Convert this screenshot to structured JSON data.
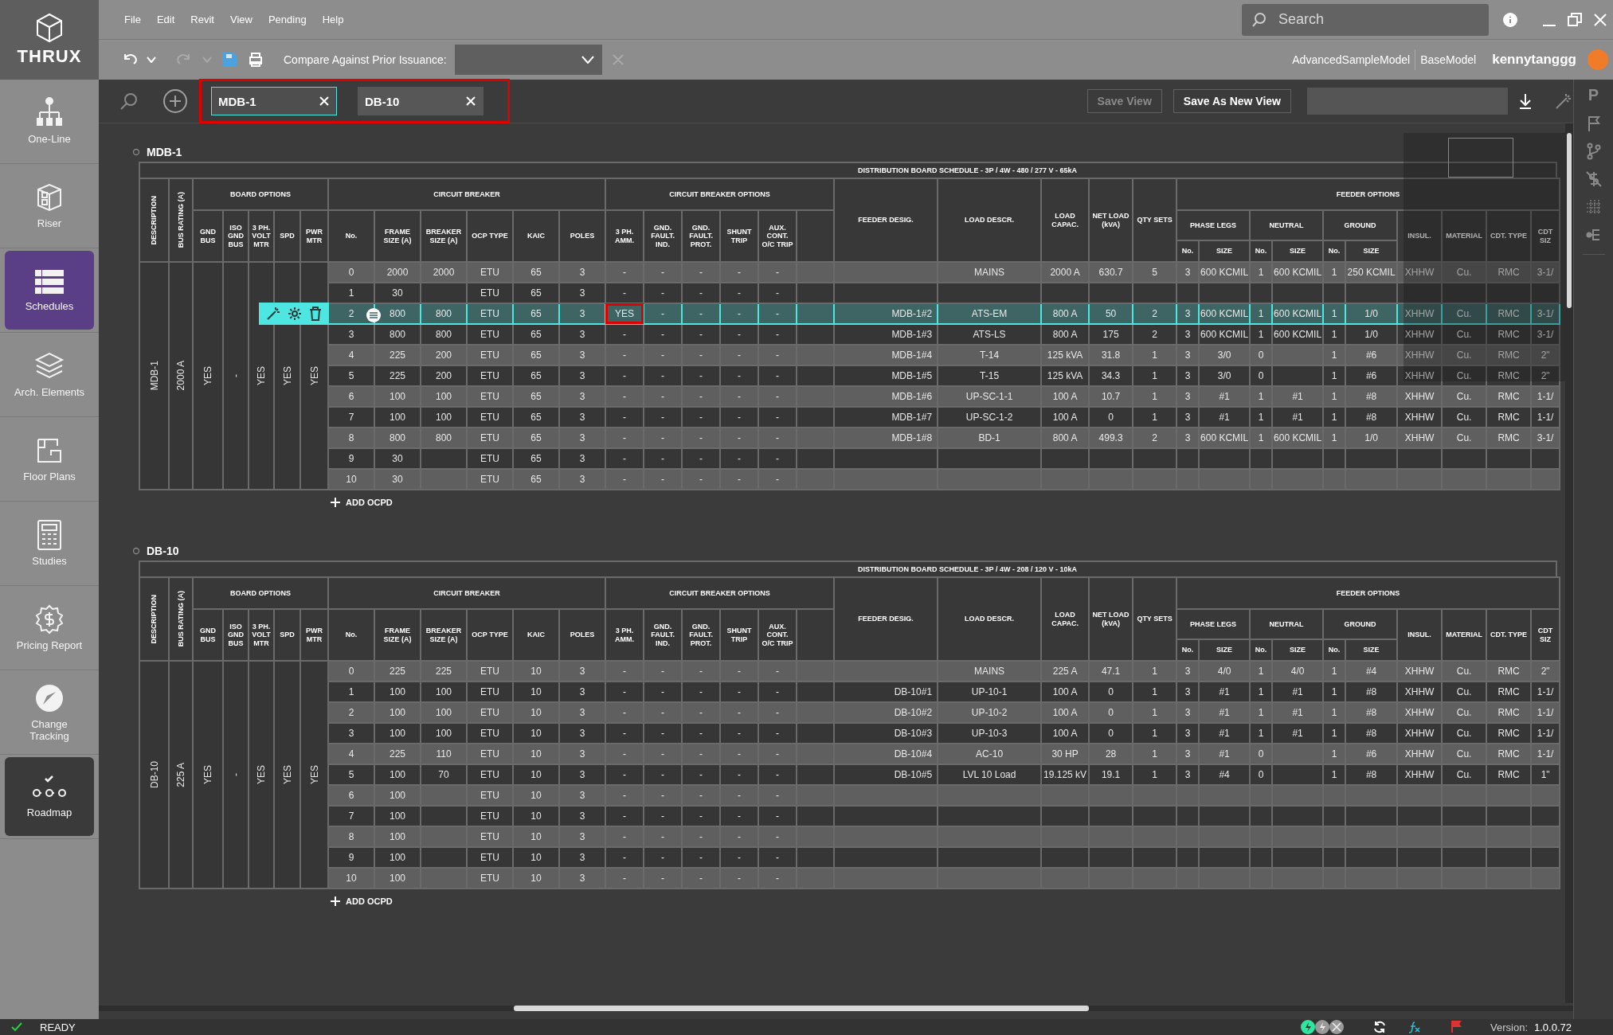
{
  "app": {
    "logo": "THRUX"
  },
  "menu": [
    "File",
    "Edit",
    "Revit",
    "View",
    "Pending",
    "Help"
  ],
  "search": {
    "placeholder": "Search"
  },
  "toolbar": {
    "compare_label": "Compare Against Prior Issuance:",
    "models": [
      "AdvancedSampleModel",
      "BaseModel"
    ],
    "user": "kennytanggg"
  },
  "sidebar": {
    "items": [
      {
        "kind": "one-line",
        "label": "One-Line",
        "selected": false,
        "hovered": false
      },
      {
        "kind": "riser",
        "label": "Riser",
        "selected": false,
        "hovered": false
      },
      {
        "kind": "schedules",
        "label": "Schedules",
        "selected": true,
        "hovered": false
      },
      {
        "kind": "arch",
        "label": "Arch. Elements",
        "selected": false,
        "hovered": false
      },
      {
        "kind": "floor",
        "label": "Floor Plans",
        "selected": false,
        "hovered": false
      },
      {
        "kind": "studies",
        "label": "Studies",
        "selected": false,
        "hovered": false
      },
      {
        "kind": "pricing",
        "label": "Pricing Report",
        "selected": false,
        "hovered": false
      },
      {
        "kind": "tracking",
        "label": "Change Tracking",
        "selected": false,
        "hovered": false
      },
      {
        "kind": "roadmap",
        "label": "Roadmap",
        "selected": false,
        "hovered": true
      }
    ]
  },
  "view_bar": {
    "tabs": [
      {
        "label": "MDB-1",
        "selected": true
      },
      {
        "label": "DB-10",
        "selected": false
      }
    ],
    "tabs_highlighted": true,
    "save_view": {
      "label": "Save View",
      "disabled": true
    },
    "save_as": {
      "label": "Save As New View",
      "disabled": false
    }
  },
  "schedules": [
    {
      "name": "MDB-1",
      "title": "DISTRIBUTION BOARD SCHEDULE - 3P / 4W - 480 / 277 V - 65kA",
      "header": {
        "description": "DESCRIPTION",
        "bus_rating": "BUS RATING (A)",
        "board_options": "BOARD OPTIONS",
        "board_columns": [
          "GND BUS",
          "ISO GND BUS",
          "3 PH. VOLT MTR",
          "SPD",
          "PWR MTR"
        ],
        "circuit_breaker": "CIRCUIT BREAKER",
        "breaker_columns": [
          "No.",
          "FRAME SIZE (A)",
          "BREAKER SIZE (A)",
          "OCP TYPE",
          "KAIC",
          "POLES"
        ],
        "cb_options": "CIRCUIT BREAKER OPTIONS",
        "option_columns": [
          "3 PH. AMM.",
          "GND. FAULT. IND.",
          "GND. FAULT. PROT.",
          "SHUNT TRIP",
          "AUX. CONT. O/C TRIP"
        ],
        "feeder_columns": [
          "FEEDER DESIG.",
          "LOAD DESCR.",
          "LOAD CAPAC.",
          "NET LOAD (kVA)",
          "QTY SETS"
        ],
        "feeder_options": "FEEDER OPTIONS",
        "conductor_groups": [
          {
            "label": "PHASE LEGS",
            "columns": [
              "No.",
              "SIZE"
            ]
          },
          {
            "label": "NEUTRAL",
            "columns": [
              "No.",
              "SIZE"
            ]
          },
          {
            "label": "GROUND",
            "columns": [
              "No.",
              "SIZE"
            ]
          }
        ],
        "cable_columns": [
          "INSUL.",
          "MATERIAL",
          "CDT. TYPE",
          "CDT SIZ"
        ]
      },
      "description": "MDB-1",
      "bus_rating": "2000 A",
      "board_options": [
        "YES",
        "-",
        "YES",
        "YES",
        "YES"
      ],
      "rows": [
        {
          "selected": false,
          "flagged": false,
          "no": "0",
          "frame": "2000",
          "breaker": "2000",
          "ocp": "ETU",
          "kaic": "65",
          "poles": "3",
          "options": [
            "-",
            "-",
            "-",
            "-",
            "-"
          ],
          "load": "MAINS",
          "capac": "2000 A",
          "net": "630.7",
          "qty": "5",
          "phase_no": "3",
          "phase_size": "600 KCMIL",
          "neutral_no": "1",
          "neutral_size": "600 KCMIL",
          "ground_no": "1",
          "ground_size": "250 KCMIL",
          "insul": "XHHW",
          "material": "Cu.",
          "cdt_type": "RMC",
          "cdt_size": "3-1/"
        },
        {
          "selected": false,
          "flagged": false,
          "no": "1",
          "frame": "30",
          "ocp": "ETU",
          "kaic": "65",
          "poles": "3",
          "options": [
            "-",
            "-",
            "-",
            "-",
            "-"
          ]
        },
        {
          "selected": true,
          "flagged": true,
          "no": "2",
          "frame": "800",
          "breaker": "800",
          "ocp": "ETU",
          "kaic": "65",
          "poles": "3",
          "options": [
            "YES",
            "-",
            "-",
            "-",
            "-"
          ],
          "feeder": "MDB-1#2",
          "load": "ATS-EM",
          "capac": "800 A",
          "net": "50",
          "qty": "2",
          "phase_no": "3",
          "phase_size": "600 KCMIL",
          "neutral_no": "1",
          "neutral_size": "600 KCMIL",
          "ground_no": "1",
          "ground_size": "1/0",
          "insul": "XHHW",
          "material": "Cu.",
          "cdt_type": "RMC",
          "cdt_size": "3-1/"
        },
        {
          "selected": false,
          "flagged": false,
          "no": "3",
          "frame": "800",
          "breaker": "800",
          "ocp": "ETU",
          "kaic": "65",
          "poles": "3",
          "options": [
            "-",
            "-",
            "-",
            "-",
            "-"
          ],
          "feeder": "MDB-1#3",
          "load": "ATS-LS",
          "capac": "800 A",
          "net": "175",
          "qty": "2",
          "phase_no": "3",
          "phase_size": "600 KCMIL",
          "neutral_no": "1",
          "neutral_size": "600 KCMIL",
          "ground_no": "1",
          "ground_size": "1/0",
          "insul": "XHHW",
          "material": "Cu.",
          "cdt_type": "RMC",
          "cdt_size": "3-1/"
        },
        {
          "selected": false,
          "flagged": false,
          "no": "4",
          "frame": "225",
          "breaker": "200",
          "ocp": "ETU",
          "kaic": "65",
          "poles": "3",
          "options": [
            "-",
            "-",
            "-",
            "-",
            "-"
          ],
          "feeder": "MDB-1#4",
          "load": "T-14",
          "capac": "125 kVA",
          "net": "31.8",
          "qty": "1",
          "phase_no": "3",
          "phase_size": "3/0",
          "neutral_no": "0",
          "ground_no": "1",
          "ground_size": "#6",
          "insul": "XHHW",
          "material": "Cu.",
          "cdt_type": "RMC",
          "cdt_size": "2\""
        },
        {
          "selected": false,
          "flagged": false,
          "no": "5",
          "frame": "225",
          "breaker": "200",
          "ocp": "ETU",
          "kaic": "65",
          "poles": "3",
          "options": [
            "-",
            "-",
            "-",
            "-",
            "-"
          ],
          "feeder": "MDB-1#5",
          "load": "T-15",
          "capac": "125 kVA",
          "net": "34.3",
          "qty": "1",
          "phase_no": "3",
          "phase_size": "3/0",
          "neutral_no": "0",
          "ground_no": "1",
          "ground_size": "#6",
          "insul": "XHHW",
          "material": "Cu.",
          "cdt_type": "RMC",
          "cdt_size": "2\""
        },
        {
          "selected": false,
          "flagged": false,
          "no": "6",
          "frame": "100",
          "breaker": "100",
          "ocp": "ETU",
          "kaic": "65",
          "poles": "3",
          "options": [
            "-",
            "-",
            "-",
            "-",
            "-"
          ],
          "feeder": "MDB-1#6",
          "load": "UP-SC-1-1",
          "capac": "100 A",
          "net": "10.7",
          "qty": "1",
          "phase_no": "3",
          "phase_size": "#1",
          "neutral_no": "1",
          "neutral_size": "#1",
          "ground_no": "1",
          "ground_size": "#8",
          "insul": "XHHW",
          "material": "Cu.",
          "cdt_type": "RMC",
          "cdt_size": "1-1/"
        },
        {
          "selected": false,
          "flagged": false,
          "no": "7",
          "frame": "100",
          "breaker": "100",
          "ocp": "ETU",
          "kaic": "65",
          "poles": "3",
          "options": [
            "-",
            "-",
            "-",
            "-",
            "-"
          ],
          "feeder": "MDB-1#7",
          "load": "UP-SC-1-2",
          "capac": "100 A",
          "net": "0",
          "qty": "1",
          "phase_no": "3",
          "phase_size": "#1",
          "neutral_no": "1",
          "neutral_size": "#1",
          "ground_no": "1",
          "ground_size": "#8",
          "insul": "XHHW",
          "material": "Cu.",
          "cdt_type": "RMC",
          "cdt_size": "1-1/"
        },
        {
          "selected": false,
          "flagged": false,
          "no": "8",
          "frame": "800",
          "breaker": "800",
          "ocp": "ETU",
          "kaic": "65",
          "poles": "3",
          "options": [
            "-",
            "-",
            "-",
            "-",
            "-"
          ],
          "feeder": "MDB-1#8",
          "load": "BD-1",
          "capac": "800 A",
          "net": "499.3",
          "qty": "2",
          "phase_no": "3",
          "phase_size": "600 KCMIL",
          "neutral_no": "1",
          "neutral_size": "600 KCMIL",
          "ground_no": "1",
          "ground_size": "1/0",
          "insul": "XHHW",
          "material": "Cu.",
          "cdt_type": "RMC",
          "cdt_size": "3-1/"
        },
        {
          "selected": false,
          "flagged": false,
          "no": "9",
          "frame": "30",
          "ocp": "ETU",
          "kaic": "65",
          "poles": "3",
          "options": [
            "-",
            "-",
            "-",
            "-",
            "-"
          ]
        },
        {
          "selected": false,
          "flagged": false,
          "no": "10",
          "frame": "30",
          "ocp": "ETU",
          "kaic": "65",
          "poles": "3",
          "options": [
            "-",
            "-",
            "-",
            "-",
            "-"
          ]
        }
      ],
      "add_label": "ADD OCPD"
    },
    {
      "name": "DB-10",
      "title": "DISTRIBUTION BOARD SCHEDULE - 3P / 4W - 208 / 120 V - 10kA",
      "header": {
        "description": "DESCRIPTION",
        "bus_rating": "BUS RATING (A)",
        "board_options": "BOARD OPTIONS",
        "board_columns": [
          "GND BUS",
          "ISO GND BUS",
          "3 PH. VOLT MTR",
          "SPD",
          "PWR MTR"
        ],
        "circuit_breaker": "CIRCUIT BREAKER",
        "breaker_columns": [
          "No.",
          "FRAME SIZE (A)",
          "BREAKER SIZE (A)",
          "OCP TYPE",
          "KAIC",
          "POLES"
        ],
        "cb_options": "CIRCUIT BREAKER OPTIONS",
        "option_columns": [
          "3 PH. AMM.",
          "GND. FAULT. IND.",
          "GND. FAULT. PROT.",
          "SHUNT TRIP",
          "AUX. CONT. O/C TRIP"
        ],
        "feeder_columns": [
          "FEEDER DESIG.",
          "LOAD DESCR.",
          "LOAD CAPAC.",
          "NET LOAD (kVA)",
          "QTY SETS"
        ],
        "feeder_options": "FEEDER OPTIONS",
        "conductor_groups": [
          {
            "label": "PHASE LEGS",
            "columns": [
              "No.",
              "SIZE"
            ]
          },
          {
            "label": "NEUTRAL",
            "columns": [
              "No.",
              "SIZE"
            ]
          },
          {
            "label": "GROUND",
            "columns": [
              "No.",
              "SIZE"
            ]
          }
        ],
        "cable_columns": [
          "INSUL.",
          "MATERIAL",
          "CDT. TYPE",
          "CDT SIZ"
        ]
      },
      "description": "DB-10",
      "bus_rating": "225 A",
      "board_options": [
        "YES",
        "-",
        "YES",
        "YES",
        "YES"
      ],
      "rows": [
        {
          "selected": false,
          "flagged": false,
          "no": "0",
          "frame": "225",
          "breaker": "225",
          "ocp": "ETU",
          "kaic": "10",
          "poles": "3",
          "options": [
            "-",
            "-",
            "-",
            "-",
            "-"
          ],
          "load": "MAINS",
          "capac": "225 A",
          "net": "47.1",
          "qty": "1",
          "phase_no": "3",
          "phase_size": "4/0",
          "neutral_no": "1",
          "neutral_size": "4/0",
          "ground_no": "1",
          "ground_size": "#4",
          "insul": "XHHW",
          "material": "Cu.",
          "cdt_type": "RMC",
          "cdt_size": "2\""
        },
        {
          "selected": false,
          "flagged": false,
          "no": "1",
          "frame": "100",
          "breaker": "100",
          "ocp": "ETU",
          "kaic": "10",
          "poles": "3",
          "options": [
            "-",
            "-",
            "-",
            "-",
            "-"
          ],
          "feeder": "DB-10#1",
          "load": "UP-10-1",
          "capac": "100 A",
          "net": "0",
          "qty": "1",
          "phase_no": "3",
          "phase_size": "#1",
          "neutral_no": "1",
          "neutral_size": "#1",
          "ground_no": "1",
          "ground_size": "#8",
          "insul": "XHHW",
          "material": "Cu.",
          "cdt_type": "RMC",
          "cdt_size": "1-1/"
        },
        {
          "selected": false,
          "flagged": false,
          "no": "2",
          "frame": "100",
          "breaker": "100",
          "ocp": "ETU",
          "kaic": "10",
          "poles": "3",
          "options": [
            "-",
            "-",
            "-",
            "-",
            "-"
          ],
          "feeder": "DB-10#2",
          "load": "UP-10-2",
          "capac": "100 A",
          "net": "0",
          "qty": "1",
          "phase_no": "3",
          "phase_size": "#1",
          "neutral_no": "1",
          "neutral_size": "#1",
          "ground_no": "1",
          "ground_size": "#8",
          "insul": "XHHW",
          "material": "Cu.",
          "cdt_type": "RMC",
          "cdt_size": "1-1/"
        },
        {
          "selected": false,
          "flagged": false,
          "no": "3",
          "frame": "100",
          "breaker": "100",
          "ocp": "ETU",
          "kaic": "10",
          "poles": "3",
          "options": [
            "-",
            "-",
            "-",
            "-",
            "-"
          ],
          "feeder": "DB-10#3",
          "load": "UP-10-3",
          "capac": "100 A",
          "net": "0",
          "qty": "1",
          "phase_no": "3",
          "phase_size": "#1",
          "neutral_no": "1",
          "neutral_size": "#1",
          "ground_no": "1",
          "ground_size": "#8",
          "insul": "XHHW",
          "material": "Cu.",
          "cdt_type": "RMC",
          "cdt_size": "1-1/"
        },
        {
          "selected": false,
          "flagged": false,
          "no": "4",
          "frame": "225",
          "breaker": "110",
          "ocp": "ETU",
          "kaic": "10",
          "poles": "3",
          "options": [
            "-",
            "-",
            "-",
            "-",
            "-"
          ],
          "feeder": "DB-10#4",
          "load": "AC-10",
          "capac": "30 HP",
          "net": "28",
          "qty": "1",
          "phase_no": "3",
          "phase_size": "#1",
          "neutral_no": "0",
          "ground_no": "1",
          "ground_size": "#6",
          "insul": "XHHW",
          "material": "Cu.",
          "cdt_type": "RMC",
          "cdt_size": "1-1/"
        },
        {
          "selected": false,
          "flagged": false,
          "no": "5",
          "frame": "100",
          "breaker": "70",
          "ocp": "ETU",
          "kaic": "10",
          "poles": "3",
          "options": [
            "-",
            "-",
            "-",
            "-",
            "-"
          ],
          "feeder": "DB-10#5",
          "load": "LVL 10 Load",
          "capac": "19.125 kV",
          "net": "19.1",
          "qty": "1",
          "phase_no": "3",
          "phase_size": "#4",
          "neutral_no": "0",
          "ground_no": "1",
          "ground_size": "#8",
          "insul": "XHHW",
          "material": "Cu.",
          "cdt_type": "RMC",
          "cdt_size": "1\""
        },
        {
          "selected": false,
          "flagged": false,
          "no": "6",
          "frame": "100",
          "ocp": "ETU",
          "kaic": "10",
          "poles": "3",
          "options": [
            "-",
            "-",
            "-",
            "-",
            "-"
          ]
        },
        {
          "selected": false,
          "flagged": false,
          "no": "7",
          "frame": "100",
          "ocp": "ETU",
          "kaic": "10",
          "poles": "3",
          "options": [
            "-",
            "-",
            "-",
            "-",
            "-"
          ]
        },
        {
          "selected": false,
          "flagged": false,
          "no": "8",
          "frame": "100",
          "ocp": "ETU",
          "kaic": "10",
          "poles": "3",
          "options": [
            "-",
            "-",
            "-",
            "-",
            "-"
          ]
        },
        {
          "selected": false,
          "flagged": false,
          "no": "9",
          "frame": "100",
          "ocp": "ETU",
          "kaic": "10",
          "poles": "3",
          "options": [
            "-",
            "-",
            "-",
            "-",
            "-"
          ]
        },
        {
          "selected": false,
          "flagged": false,
          "no": "10",
          "frame": "100",
          "ocp": "ETU",
          "kaic": "10",
          "poles": "3",
          "options": [
            "-",
            "-",
            "-",
            "-",
            "-"
          ]
        }
      ],
      "add_label": "ADD OCPD"
    }
  ],
  "right_rail": {
    "label": "P"
  },
  "status_bar": {
    "status": "READY",
    "version_label": "Version:",
    "version": "1.0.0.72"
  }
}
